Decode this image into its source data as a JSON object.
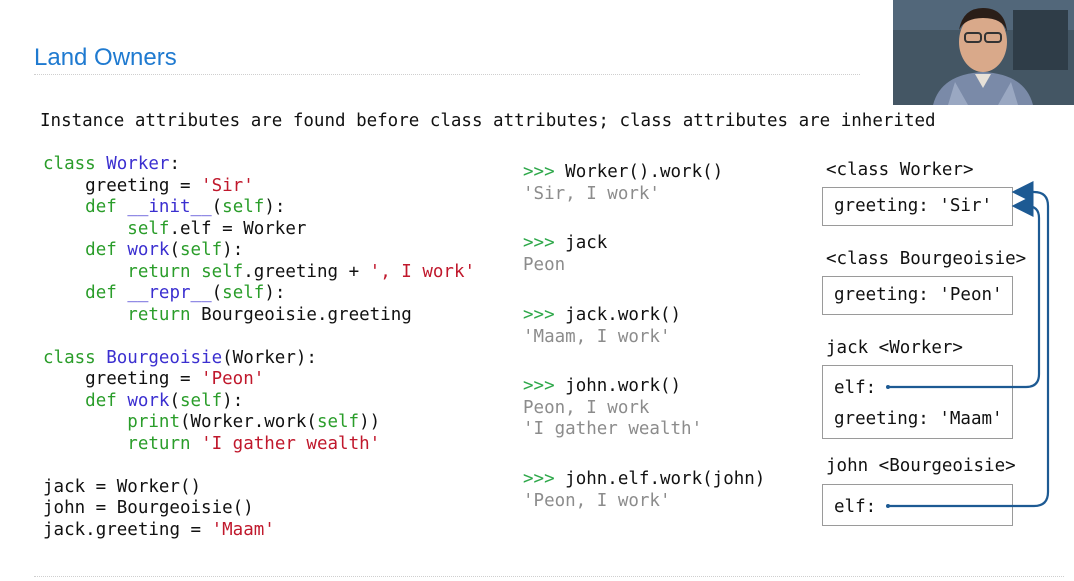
{
  "slide": {
    "title": "Land Owners",
    "subtitle": "Instance attributes are found before class attributes; class attributes are inherited"
  },
  "code": {
    "lines": [
      [
        {
          "t": "class ",
          "c": "kw"
        },
        {
          "t": "Worker",
          "c": "nm"
        },
        {
          "t": ":",
          "c": ""
        }
      ],
      [
        {
          "t": "    greeting = ",
          "c": ""
        },
        {
          "t": "'Sir'",
          "c": "str"
        }
      ],
      [
        {
          "t": "    ",
          "c": ""
        },
        {
          "t": "def ",
          "c": "kw"
        },
        {
          "t": "__init__",
          "c": "nm"
        },
        {
          "t": "(",
          "c": ""
        },
        {
          "t": "self",
          "c": "kw"
        },
        {
          "t": "):",
          "c": ""
        }
      ],
      [
        {
          "t": "        ",
          "c": ""
        },
        {
          "t": "self",
          "c": "kw"
        },
        {
          "t": ".elf = Worker",
          "c": ""
        }
      ],
      [
        {
          "t": "    ",
          "c": ""
        },
        {
          "t": "def ",
          "c": "kw"
        },
        {
          "t": "work",
          "c": "nm"
        },
        {
          "t": "(",
          "c": ""
        },
        {
          "t": "self",
          "c": "kw"
        },
        {
          "t": "):",
          "c": ""
        }
      ],
      [
        {
          "t": "        ",
          "c": ""
        },
        {
          "t": "return ",
          "c": "kw"
        },
        {
          "t": "self",
          "c": "kw"
        },
        {
          "t": ".greeting + ",
          "c": ""
        },
        {
          "t": "', I work'",
          "c": "str"
        }
      ],
      [
        {
          "t": "    ",
          "c": ""
        },
        {
          "t": "def ",
          "c": "kw"
        },
        {
          "t": "__repr__",
          "c": "nm"
        },
        {
          "t": "(",
          "c": ""
        },
        {
          "t": "self",
          "c": "kw"
        },
        {
          "t": "):",
          "c": ""
        }
      ],
      [
        {
          "t": "        ",
          "c": ""
        },
        {
          "t": "return ",
          "c": "kw"
        },
        {
          "t": "Bourgeoisie.greeting",
          "c": ""
        }
      ],
      [
        {
          "t": "",
          "c": ""
        }
      ],
      [
        {
          "t": "class ",
          "c": "kw"
        },
        {
          "t": "Bourgeoisie",
          "c": "nm"
        },
        {
          "t": "(Worker):",
          "c": ""
        }
      ],
      [
        {
          "t": "    greeting = ",
          "c": ""
        },
        {
          "t": "'Peon'",
          "c": "str"
        }
      ],
      [
        {
          "t": "    ",
          "c": ""
        },
        {
          "t": "def ",
          "c": "kw"
        },
        {
          "t": "work",
          "c": "nm"
        },
        {
          "t": "(",
          "c": ""
        },
        {
          "t": "self",
          "c": "kw"
        },
        {
          "t": "):",
          "c": ""
        }
      ],
      [
        {
          "t": "        ",
          "c": ""
        },
        {
          "t": "print",
          "c": "kw"
        },
        {
          "t": "(Worker.work(",
          "c": ""
        },
        {
          "t": "self",
          "c": "kw"
        },
        {
          "t": "))",
          "c": ""
        }
      ],
      [
        {
          "t": "        ",
          "c": ""
        },
        {
          "t": "return ",
          "c": "kw"
        },
        {
          "t": "'I gather wealth'",
          "c": "str"
        }
      ],
      [
        {
          "t": "",
          "c": ""
        }
      ],
      [
        {
          "t": "jack = Worker()",
          "c": ""
        }
      ],
      [
        {
          "t": "john = Bourgeoisie()",
          "c": ""
        }
      ],
      [
        {
          "t": "jack",
          "c": ""
        },
        {
          "t": ".greeting = ",
          "c": ""
        },
        {
          "t": "'Maam'",
          "c": "str"
        }
      ]
    ]
  },
  "session": {
    "prompt": ">>>",
    "entries": [
      {
        "cmd": "Worker().work()",
        "out": [
          "'Sir, I work'"
        ]
      },
      {
        "cmd": "jack",
        "out": [
          "Peon"
        ]
      },
      {
        "cmd": "jack.work()",
        "out": [
          "'Maam, I work'"
        ]
      },
      {
        "cmd": "john.work()",
        "out": [
          "Peon, I work",
          "'I gather wealth'"
        ]
      },
      {
        "cmd": "john.elf.work(john)",
        "out": [
          "'Peon, I work'"
        ]
      }
    ]
  },
  "diagram": {
    "worker_label": "<class Worker>",
    "worker_attr": "greeting: 'Sir'",
    "bourg_label": "<class Bourgeoisie>",
    "bourg_attr": "greeting: 'Peon'",
    "jack_label": "jack <Worker>",
    "jack_elf": "elf:",
    "jack_greeting": "greeting: 'Maam'",
    "john_label": "john <Bourgeoisie>",
    "john_elf": "elf:"
  },
  "colors": {
    "title": "#1f7ad0",
    "keyword": "#2a9d2a",
    "name": "#3b2fd0",
    "string": "#c0182c",
    "prompt": "#2ea84a",
    "output": "#8c8c8c",
    "arrow": "#1d5a93"
  },
  "video": {
    "icon": "presenter-video-icon"
  }
}
